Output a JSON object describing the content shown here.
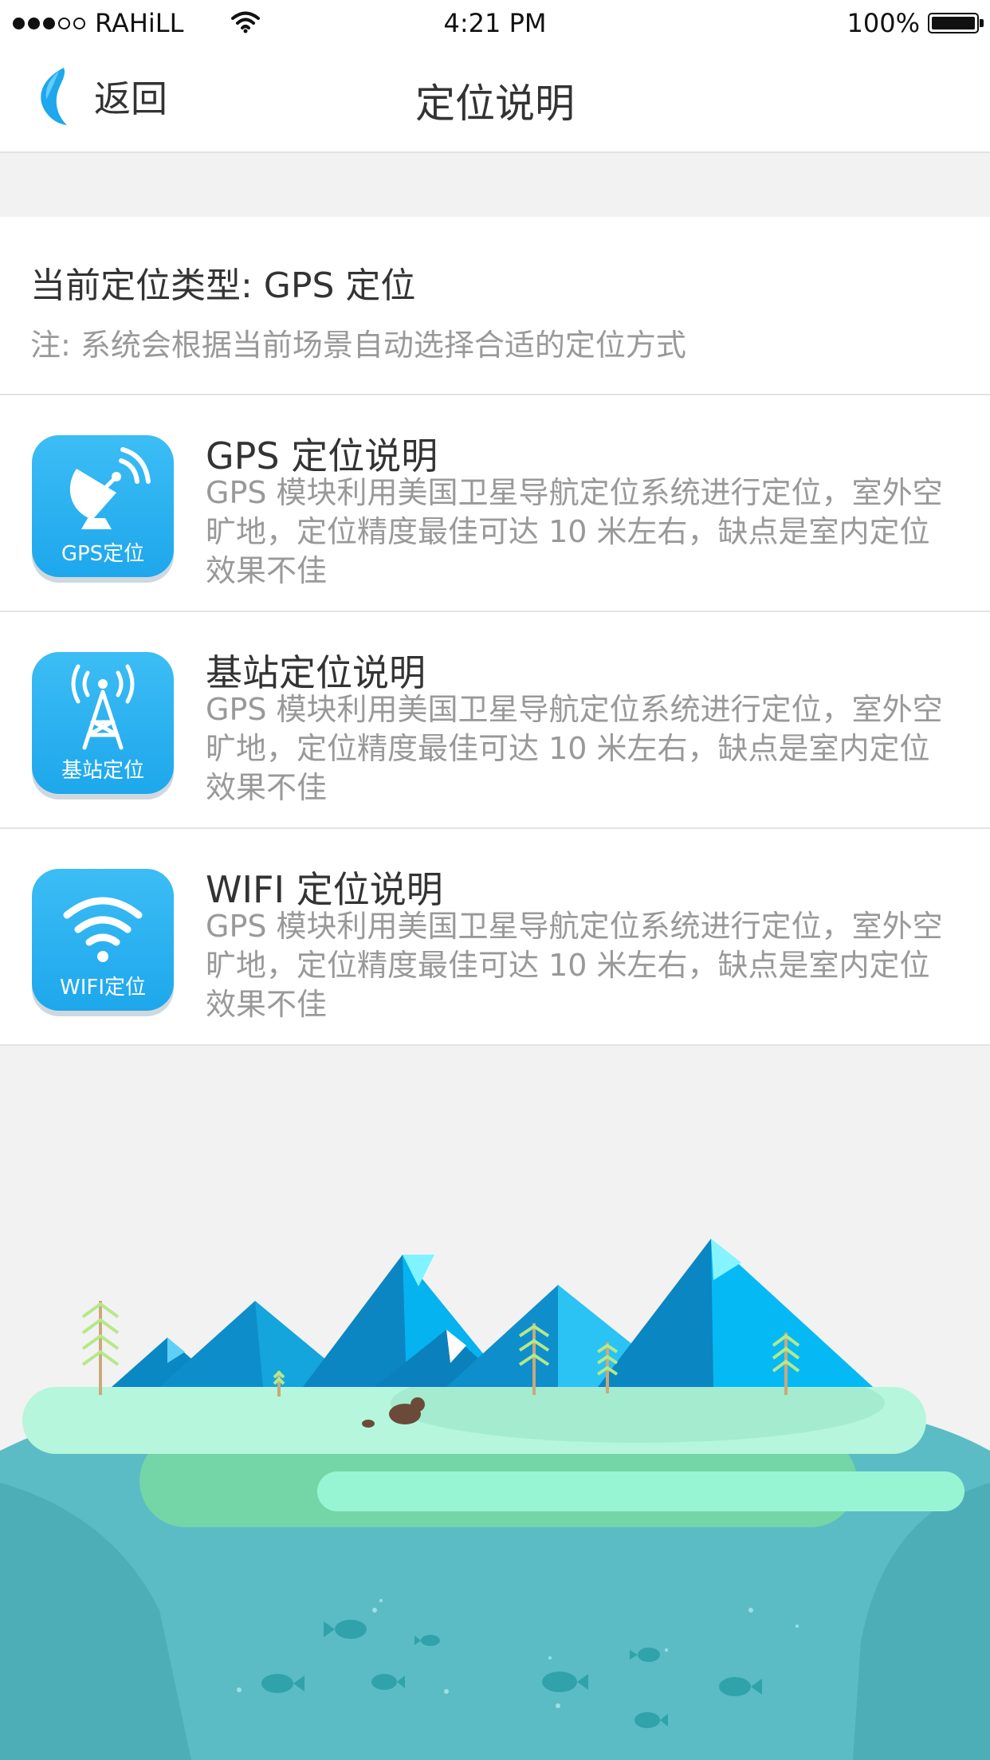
{
  "status_bar": {
    "carrier": "RAHiLL",
    "time": "4:21 PM",
    "battery": "100%"
  },
  "nav": {
    "back_label": "返回",
    "title": "定位说明"
  },
  "current": {
    "type_text": "当前定位类型:  GPS 定位",
    "note": "注:  系统会根据当前场景自动选择合适的定位方式"
  },
  "items": [
    {
      "icon": "satellite-dish-icon",
      "icon_label": "GPS定位",
      "title": "GPS 定位说明",
      "description": "GPS 模块利用美国卫星导航定位系统进行定位，室外空旷地，定位精度最佳可达 10 米左右，缺点是室内定位效果不佳"
    },
    {
      "icon": "signal-tower-icon",
      "icon_label": "基站定位",
      "title": "基站定位说明",
      "description": "GPS 模块利用美国卫星导航定位系统进行定位，室外空旷地，定位精度最佳可达 10 米左右，缺点是室内定位效果不佳"
    },
    {
      "icon": "wifi-icon",
      "icon_label": "WIFI定位",
      "title": "WIFI 定位说明",
      "description": "GPS 模块利用美国卫星导航定位系统进行定位，室外空旷地，定位精度最佳可达 10 米左右，缺点是室内定位效果不佳"
    }
  ],
  "colors": {
    "accent": "#1ea7ec",
    "text_primary": "#333333",
    "text_secondary": "#999999",
    "background": "#f2f2f2"
  }
}
